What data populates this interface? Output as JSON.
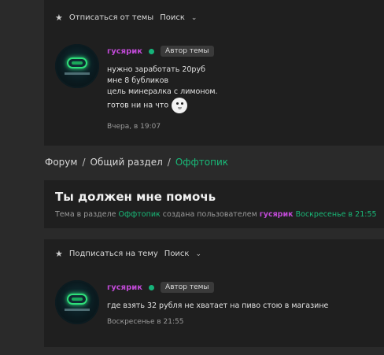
{
  "top_toolbar": {
    "unsubscribe": "Отписаться от темы",
    "search": "Поиск"
  },
  "first_post": {
    "username": "гусярик",
    "badge": "Автор темы",
    "lines": [
      "нужно заработать 20руб",
      "мне 8 бубликов",
      "цель минералка с лимоном.",
      "готов ни на что"
    ],
    "time": "Вчера, в 19:07"
  },
  "breadcrumb": {
    "forum": "Форум",
    "section": "Общий раздел",
    "current": "Оффтопик"
  },
  "thread": {
    "title": "Ты должен мне помочь",
    "desc_prefix": "Тема в разделе",
    "section": "Оффтопик",
    "desc_mid": "создана пользователем",
    "author": "гусярик",
    "date": "Воскресенье в 21:55"
  },
  "bottom_toolbar": {
    "subscribe": "Подписаться на тему",
    "search": "Поиск"
  },
  "second_post": {
    "username": "гусярик",
    "badge": "Автор темы",
    "text": "где взять 32 рубля не хватает на пиво стою в магазине",
    "time": "Воскресенье в 21:55"
  }
}
